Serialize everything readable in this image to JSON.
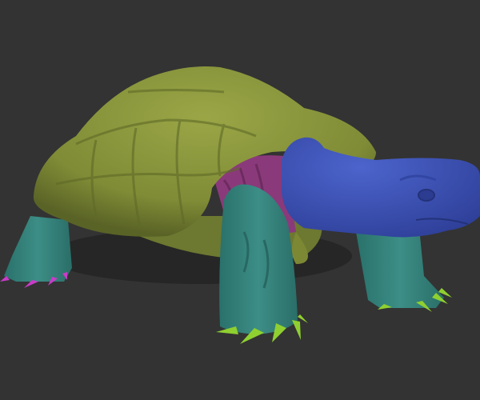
{
  "scene": {
    "subject": "turtle",
    "colors": {
      "background": "#333333",
      "shell": "#84903a",
      "shell_light": "#98a444",
      "shell_dark": "#5c6526",
      "skin_teal": "#2f7d77",
      "skin_teal_light": "#3d8f87",
      "head_blue": "#3a4fb2",
      "head_blue_light": "#4a62c8",
      "underbody_magenta": "#8a3a7a",
      "claws_green": "#8fd030",
      "claws_pink": "#c83cc8"
    }
  }
}
